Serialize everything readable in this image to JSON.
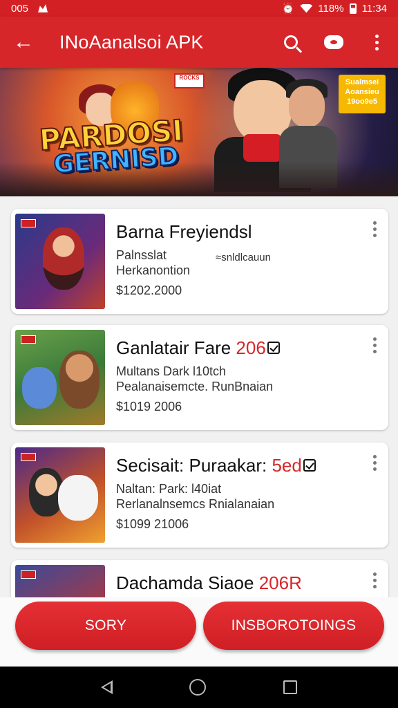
{
  "status_bar": {
    "left_text": "005",
    "battery_text": "118%",
    "time": "11:34"
  },
  "app_bar": {
    "title": "INoAanalsoi APK",
    "back_icon": "arrow-back-icon",
    "search_icon": "search-icon",
    "chat_icon": "chat-icon",
    "more_icon": "more-vert-icon",
    "color": "#d7262a"
  },
  "banner": {
    "logo_line1": "PARDOSI",
    "logo_line2": "GERNISD",
    "badge_text": "Sualmsei Aoansieu 19oo9e5",
    "tag_text": "ROCKS"
  },
  "items": [
    {
      "title": "Barna Freyiendsl",
      "title_accent": "",
      "sub1": "Palnsslat",
      "sub2": "Herkanontion",
      "note": "≈snldlcauun",
      "price": "$1202.2000"
    },
    {
      "title": "Ganlatair Fare ",
      "title_accent": "206",
      "sub1": "Multans Dark l10tch",
      "sub2": "Pealanaisemcte. RunBnaian",
      "note": "",
      "price": "$1019 2006"
    },
    {
      "title": "Secisait: Puraakar: ",
      "title_accent": "5ed",
      "sub1": "Naltan: Park: l40iat",
      "sub2": "Rerlanalnsemcs Rnialanaian",
      "note": "",
      "price": "$1099 21006"
    },
    {
      "title": "Dachamda Siaoe ",
      "title_accent": "206R",
      "sub1": "",
      "sub2": "",
      "note": "",
      "price": ""
    }
  ],
  "buttons": {
    "left_label": "SORY",
    "right_label": "INSBOROTOINGS"
  },
  "colors": {
    "accent": "#d7262a",
    "background": "#f1f1f1"
  }
}
